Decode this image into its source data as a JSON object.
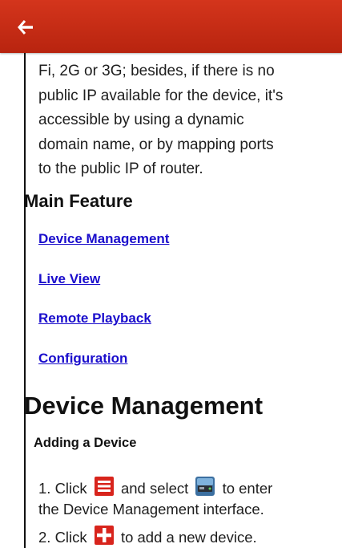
{
  "appbar": {
    "back_icon": "arrow-left-icon",
    "color": "#c62d16"
  },
  "intro_lines": [
    "Fi, 2G or 3G; besides, if there is no",
    "public IP available for the device, it's",
    "accessible by using a dynamic",
    "domain name, or by mapping ports",
    "to the public IP of router."
  ],
  "main_feature": {
    "heading": "Main Feature",
    "links": [
      "Device Management",
      "Live View",
      "Remote Playback",
      "Configuration"
    ]
  },
  "device_management": {
    "heading": "Device Management",
    "subheading": "Adding a Device",
    "step1": {
      "prefix": "1. Click",
      "icon1": "menu-icon",
      "middle": "and select",
      "icon2": "device-icon",
      "suffix": "to enter",
      "line2": "the Device Management interface."
    },
    "step2": {
      "prefix": "2. Click",
      "icon": "add-icon",
      "suffix": "to add a new device."
    }
  }
}
